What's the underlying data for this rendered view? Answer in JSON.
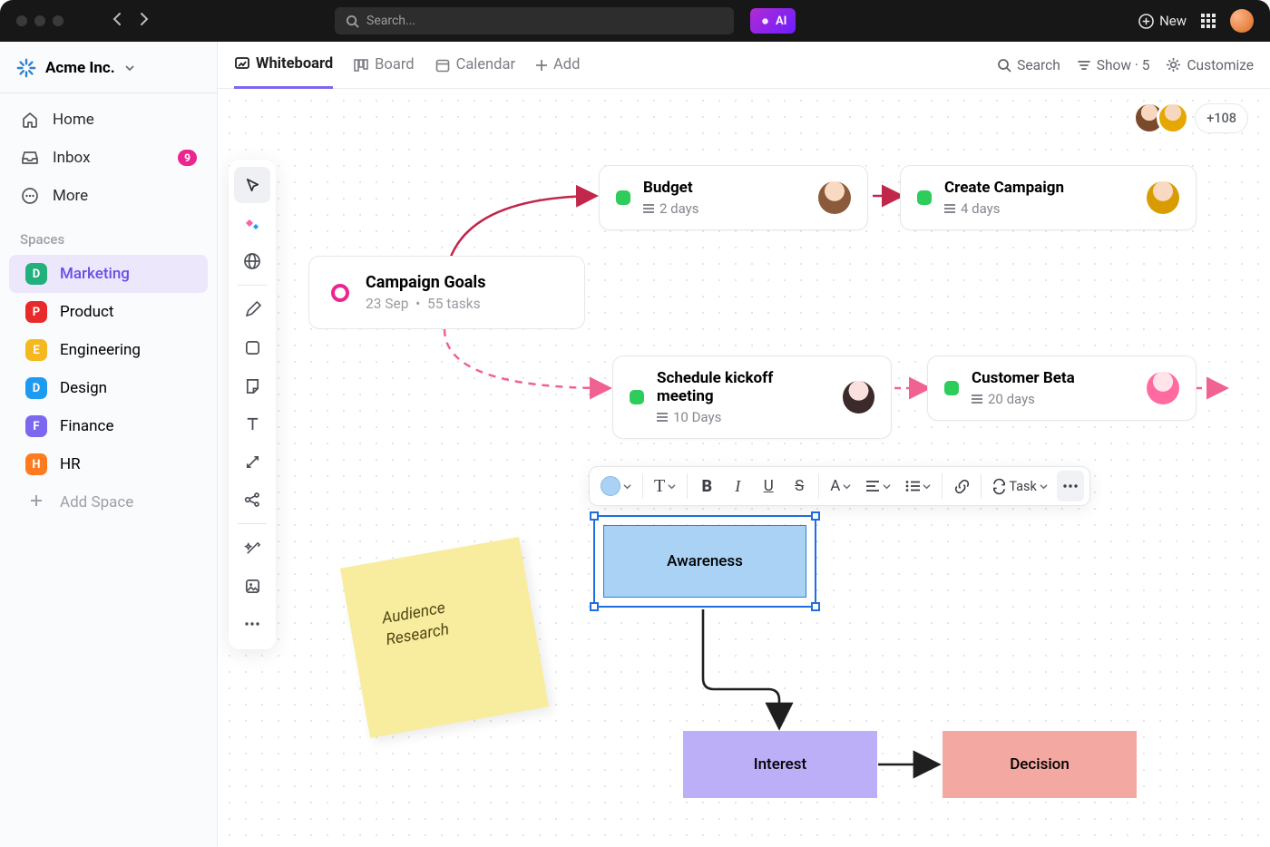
{
  "titlebar": {
    "search_placeholder": "Search...",
    "ai_label": "AI",
    "new_label": "New"
  },
  "workspace": {
    "name": "Acme Inc."
  },
  "sidebar": {
    "nav": [
      {
        "label": "Home"
      },
      {
        "label": "Inbox",
        "badge": "9"
      },
      {
        "label": "More"
      }
    ],
    "section_label": "Spaces",
    "spaces": [
      {
        "letter": "D",
        "label": "Marketing",
        "color": "#22b07d"
      },
      {
        "letter": "P",
        "label": "Product",
        "color": "#e92a2a"
      },
      {
        "letter": "E",
        "label": "Engineering",
        "color": "#f5b91f"
      },
      {
        "letter": "D",
        "label": "Design",
        "color": "#1e9bf0"
      },
      {
        "letter": "F",
        "label": "Finance",
        "color": "#7b68ee"
      },
      {
        "letter": "H",
        "label": "HR",
        "color": "#ff7b1f"
      }
    ],
    "add_space": "Add Space"
  },
  "views": {
    "tabs": [
      {
        "label": "Whiteboard"
      },
      {
        "label": "Board"
      },
      {
        "label": "Calendar"
      },
      {
        "label": "Add"
      }
    ],
    "right": {
      "search": "Search",
      "show": "Show · 5",
      "customize": "Customize"
    }
  },
  "presence": {
    "overflow": "+108"
  },
  "campaign": {
    "title": "Campaign Goals",
    "date": "23 Sep",
    "tasks": "55 tasks"
  },
  "cards": {
    "budget": {
      "title": "Budget",
      "meta": "2 days"
    },
    "create": {
      "title": "Create Campaign",
      "meta": "4 days"
    },
    "kickoff": {
      "title": "Schedule kickoff meeting",
      "meta": "10 Days"
    },
    "beta": {
      "title": "Customer Beta",
      "meta": "20 days"
    }
  },
  "sticky": {
    "text": "Audience Research"
  },
  "shapes": {
    "awareness": "Awareness",
    "interest": "Interest",
    "decision": "Decision"
  },
  "fmt": {
    "task_label": "Task"
  }
}
